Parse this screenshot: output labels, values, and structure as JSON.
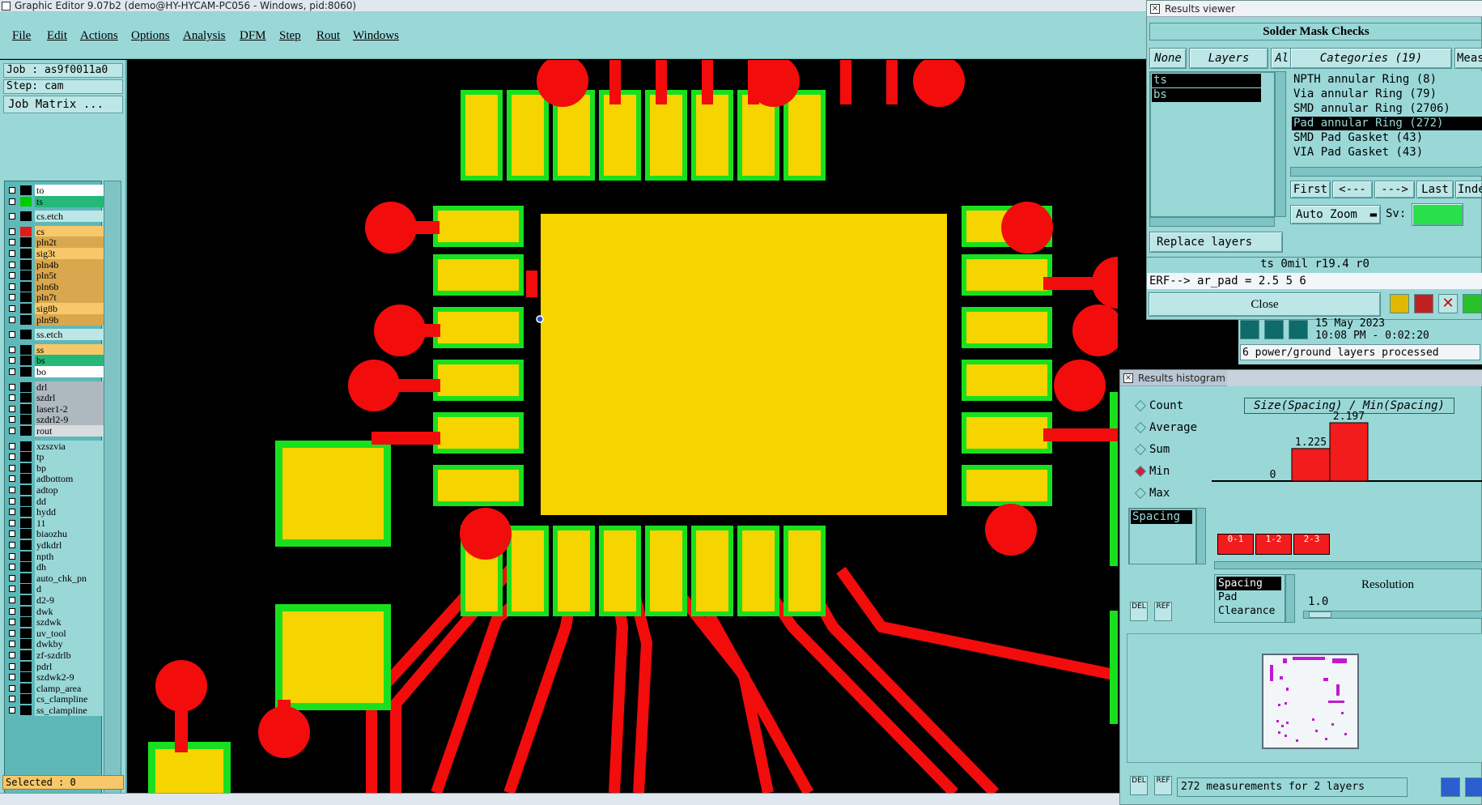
{
  "app": {
    "title": "Graphic Editor 9.07b2 (demo@HY-HYCAM-PC056 - Windows, pid:8060)",
    "menus": [
      "File",
      "Edit",
      "Actions",
      "Options",
      "Analysis",
      "DFM",
      "Step",
      "Rout",
      "Windows"
    ]
  },
  "left_panel": {
    "job": "Job : as9f0011a0",
    "step": "Step: cam",
    "job_matrix_button": "Job Matrix ...",
    "layers": [
      {
        "name": "to",
        "color": "#ffffff",
        "swatch": "#000000"
      },
      {
        "name": "ts",
        "color": "#26b87a",
        "swatch": "#00cc00"
      },
      {
        "name": "cs.etch",
        "color": "#bde6e6",
        "swatch": "#000000"
      },
      {
        "name": "cs",
        "color": "#f6c86a",
        "swatch": "#e11a1a"
      },
      {
        "name": "pln2t",
        "color": "#d9a84e",
        "swatch": "#000000"
      },
      {
        "name": "sig3t",
        "color": "#f6c86a",
        "swatch": "#000000"
      },
      {
        "name": "pln4b",
        "color": "#d9a84e",
        "swatch": "#000000"
      },
      {
        "name": "pln5t",
        "color": "#d9a84e",
        "swatch": "#000000"
      },
      {
        "name": "pln6b",
        "color": "#d9a84e",
        "swatch": "#000000"
      },
      {
        "name": "pln7t",
        "color": "#d9a84e",
        "swatch": "#000000"
      },
      {
        "name": "sig8b",
        "color": "#f6c86a",
        "swatch": "#000000"
      },
      {
        "name": "pln9b",
        "color": "#d9a84e",
        "swatch": "#000000"
      },
      {
        "name": "ss.etch",
        "color": "#bde6e6",
        "swatch": "#000000"
      },
      {
        "name": "ss",
        "color": "#f6c86a",
        "swatch": "#000000"
      },
      {
        "name": "bs",
        "color": "#26b87a",
        "swatch": "#000000"
      },
      {
        "name": "bo",
        "color": "#ffffff",
        "swatch": "#000000"
      },
      {
        "name": "drl",
        "color": "#aeb8bf",
        "swatch": "#000000"
      },
      {
        "name": "szdrl",
        "color": "#aeb8bf",
        "swatch": "#000000"
      },
      {
        "name": "laser1-2",
        "color": "#aeb8bf",
        "swatch": "#000000"
      },
      {
        "name": "szdrl2-9",
        "color": "#aeb8bf",
        "swatch": "#000000"
      },
      {
        "name": "rout",
        "color": "#d8dcde",
        "swatch": "#000000"
      },
      {
        "name": "xzszvia",
        "color": "#9ad8d8",
        "swatch": "#000000"
      },
      {
        "name": "tp",
        "color": "#9ad8d8",
        "swatch": "#000000"
      },
      {
        "name": "bp",
        "color": "#9ad8d8",
        "swatch": "#000000"
      },
      {
        "name": "adbottom",
        "color": "#9ad8d8",
        "swatch": "#000000"
      },
      {
        "name": "adtop",
        "color": "#9ad8d8",
        "swatch": "#000000"
      },
      {
        "name": "dd",
        "color": "#9ad8d8",
        "swatch": "#000000"
      },
      {
        "name": "hydd",
        "color": "#9ad8d8",
        "swatch": "#000000"
      },
      {
        "name": "11",
        "color": "#9ad8d8",
        "swatch": "#000000"
      },
      {
        "name": "biaozhu",
        "color": "#9ad8d8",
        "swatch": "#000000"
      },
      {
        "name": "ydkdrl",
        "color": "#9ad8d8",
        "swatch": "#000000"
      },
      {
        "name": "npth",
        "color": "#9ad8d8",
        "swatch": "#000000"
      },
      {
        "name": "dh",
        "color": "#9ad8d8",
        "swatch": "#000000"
      },
      {
        "name": "auto_chk_pn",
        "color": "#9ad8d8",
        "swatch": "#000000"
      },
      {
        "name": "d",
        "color": "#9ad8d8",
        "swatch": "#000000"
      },
      {
        "name": "d2-9",
        "color": "#9ad8d8",
        "swatch": "#000000"
      },
      {
        "name": "dwk",
        "color": "#9ad8d8",
        "swatch": "#000000"
      },
      {
        "name": "szdwk",
        "color": "#9ad8d8",
        "swatch": "#000000"
      },
      {
        "name": "uv_tool",
        "color": "#9ad8d8",
        "swatch": "#000000"
      },
      {
        "name": "dwkby",
        "color": "#9ad8d8",
        "swatch": "#000000"
      },
      {
        "name": "zf-szdrlb",
        "color": "#9ad8d8",
        "swatch": "#000000"
      },
      {
        "name": "pdrl",
        "color": "#9ad8d8",
        "swatch": "#000000"
      },
      {
        "name": "szdwk2-9",
        "color": "#9ad8d8",
        "swatch": "#000000"
      },
      {
        "name": "clamp_area",
        "color": "#9ad8d8",
        "swatch": "#000000"
      },
      {
        "name": "cs_clampline",
        "color": "#9ad8d8",
        "swatch": "#000000"
      },
      {
        "name": "ss_clampline",
        "color": "#9ad8d8",
        "swatch": "#000000"
      }
    ],
    "selected": "Selected : 0"
  },
  "results_viewer": {
    "window_title": "Results viewer",
    "header": "Solder Mask Checks",
    "btn_none": "None",
    "btn_layers": "Layers",
    "btn_all": "All",
    "categories_label": "Categories (19)",
    "meas_label": "Meas",
    "layers": [
      "ts",
      "bs"
    ],
    "categories": [
      "NPTH annular Ring (8)",
      "Via annular Ring (79)",
      "SMD annular Ring (2706)",
      "Pad annular Ring (272)",
      "SMD Pad Gasket (43)",
      "VIA Pad Gasket (43)"
    ],
    "selected_category_index": 3,
    "nav": {
      "first": "First",
      "prev": "<---",
      "next": "--->",
      "last": "Last",
      "index": "Index"
    },
    "auto_zoom": "Auto Zoom",
    "sv_label": "Sv:",
    "replace_layers": "Replace layers",
    "status_line": "ts 0mil  r19.4  r0",
    "erf_line": "ERF--> ar_pad = 2.5 5 6",
    "close": "Close"
  },
  "background_status": {
    "date": "15 May 2023",
    "time": "10:08 PM - 0:02:20",
    "processed": "6 power/ground layers processed"
  },
  "results_histogram": {
    "window_title": "Results histogram",
    "modes": [
      {
        "label": "Count",
        "selected": false
      },
      {
        "label": "Average",
        "selected": false
      },
      {
        "label": "Sum",
        "selected": false
      },
      {
        "label": "Min",
        "selected": true
      },
      {
        "label": "Max",
        "selected": false
      }
    ],
    "measure_list": [
      "Spacing"
    ],
    "chart_title": "Size(Spacing) / Min(Spacing)",
    "bins": [
      {
        "label": "0-1",
        "value": 0,
        "value_label": "0"
      },
      {
        "label": "1-2",
        "value": 1.225,
        "value_label": "1.225"
      },
      {
        "label": "2-3",
        "value": 2.197,
        "value_label": "2.197"
      }
    ],
    "spacing_options": [
      "Spacing",
      "Pad",
      "Clearance"
    ],
    "resolution_label": "Resolution",
    "resolution_value": "1.0",
    "footer": "272 measurements for 2 layers",
    "btn_del": "DEL",
    "btn_ref": "REF"
  },
  "canvas": {
    "bg": "#000000",
    "copper": "#f5d400",
    "mask": "#19e01e",
    "trace": "#f20c0c"
  }
}
